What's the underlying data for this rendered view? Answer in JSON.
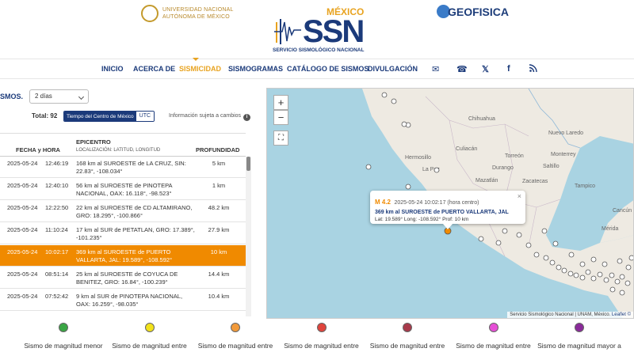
{
  "header": {
    "unam_line1": "UNIVERSIDAD NACIONAL",
    "unam_line2": "AUTÓNOMA DE MÉXICO",
    "ssn_country": "MÉXICO",
    "ssn_acronym": "SSN",
    "ssn_name": "SERVICIO SISMOLÓGICO NACIONAL",
    "geofisica": "GEOFISICA"
  },
  "nav": {
    "items": [
      "INICIO",
      "ACERCA DE",
      "SISMICIDAD",
      "SISMOGRAMAS",
      "CATÁLOGO DE SISMOS",
      "DIVULGACIÓN"
    ],
    "active": "SISMICIDAD",
    "icons": [
      "mail-icon",
      "phone-icon",
      "x-icon",
      "facebook-icon",
      "rss-icon"
    ]
  },
  "controls": {
    "label": "SMOS.",
    "range_value": "2 días",
    "total": "Total: 92",
    "tz_local": "Tiempo del Centro de México",
    "tz_utc": "UTC",
    "info_note": "Información sujeta a cambios"
  },
  "table": {
    "col_date": "FECHA y HORA",
    "col_epicenter": "EPICENTRO",
    "col_epicenter_sub": "LOCALIZACIÓN: LATITUD, LONGITUD",
    "col_depth": "PROFUNDIDAD",
    "rows": [
      {
        "date": "2025-05-24",
        "time": "12:46:19",
        "epicenter": "168 km al SUROESTE de LA CRUZ, SIN: 22.83°, -108.034°",
        "depth": "5 km"
      },
      {
        "date": "2025-05-24",
        "time": "12:40:10",
        "epicenter": "56 km al SUROESTE de PINOTEPA NACIONAL, OAX: 16.118°, -98.523°",
        "depth": "1 km"
      },
      {
        "date": "2025-05-24",
        "time": "12:22:50",
        "epicenter": "22 km al SUROESTE de CD ALTAMIRANO, GRO: 18.295°, -100.866°",
        "depth": "48.2 km"
      },
      {
        "date": "2025-05-24",
        "time": "11:10:24",
        "epicenter": "17 km al SUR de PETATLAN, GRO: 17.389°, -101.235°",
        "depth": "27.9 km"
      },
      {
        "date": "2025-05-24",
        "time": "10:02:17",
        "epicenter": "369 km al SUROESTE de PUERTO VALLARTA, JAL: 19.589°, -108.592°",
        "depth": "10 km"
      },
      {
        "date": "2025-05-24",
        "time": "08:51:14",
        "epicenter": "25 km al SUROESTE de COYUCA DE BENITEZ, GRO: 16.84°, -100.239°",
        "depth": "14.4 km"
      },
      {
        "date": "2025-05-24",
        "time": "07:52:42",
        "epicenter": "9 km al SUR de PINOTEPA NACIONAL, OAX: 16.259°, -98.035°",
        "depth": "10.4 km"
      }
    ],
    "selected_index": 4
  },
  "map": {
    "zoom_in": "+",
    "zoom_out": "−",
    "places": [
      "Chihuahua",
      "Monterrey",
      "Nuevo Laredo",
      "Torreón",
      "Saltillo",
      "Culiacán",
      "Durango",
      "La Paz",
      "Mazatlán",
      "Zacatecas",
      "Cancún",
      "Mérida",
      "Hermosillo",
      "Tampico"
    ],
    "popup": {
      "mag": "M 4.2",
      "time": "2025-05-24  10:02:17 (hora centro)",
      "location": "369 km al SUROESTE de PUERTO VALLARTA, JAL",
      "coords": "Lat: 19.589°  Long: -108.592°  Prof: 10 km"
    },
    "attribution": "Servicio Sismológico Nacional | UNAM, México. ",
    "attribution_leaflet": "Leaflet ©"
  },
  "legend": {
    "items": [
      {
        "label": "Sismo de magnitud menor",
        "color": "#3aa644"
      },
      {
        "label": "Sismo de magnitud entre",
        "color": "#f2e21a"
      },
      {
        "label": "Sismo de magnitud entre",
        "color": "#f29a3a"
      },
      {
        "label": "Sismo de magnitud entre",
        "color": "#e0443c"
      },
      {
        "label": "Sismo de magnitud entre",
        "color": "#a83a4a"
      },
      {
        "label": "Sismo de magnitud entre",
        "color": "#e64fd6"
      },
      {
        "label": "Sismo de magnitud mayor a",
        "color": "#8a2a9a"
      }
    ]
  }
}
